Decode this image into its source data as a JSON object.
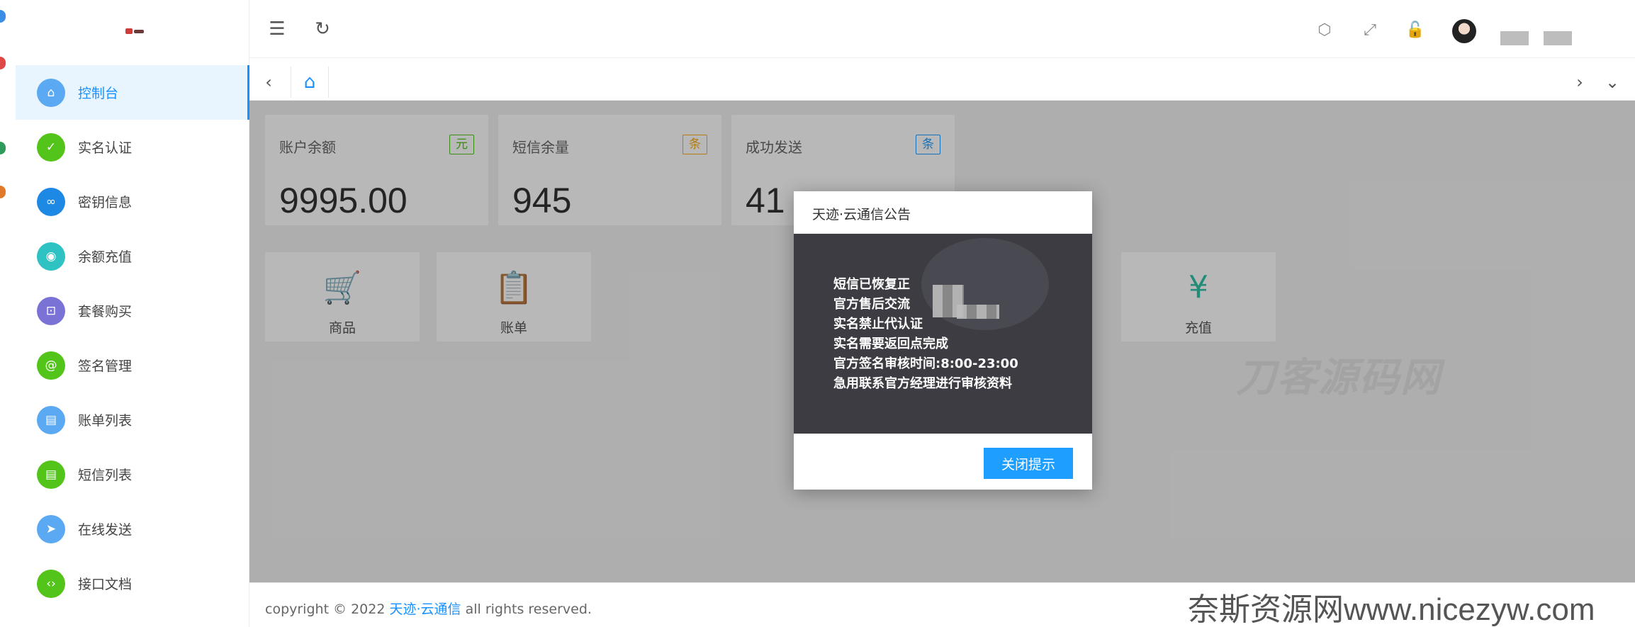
{
  "sidebar": {
    "items": [
      {
        "label": "控制台",
        "icon": "home-icon",
        "glyph": "⌂",
        "color": "#5aa9f2",
        "active": true
      },
      {
        "label": "实名认证",
        "icon": "shield-check-icon",
        "glyph": "✓",
        "color": "#52c41a",
        "active": false
      },
      {
        "label": "密钥信息",
        "icon": "link-icon",
        "glyph": "∞",
        "color": "#1e88e5",
        "active": false
      },
      {
        "label": "余额充值",
        "icon": "coin-icon",
        "glyph": "◉",
        "color": "#2fc2c2",
        "active": false
      },
      {
        "label": "套餐购买",
        "icon": "cart-icon",
        "glyph": "⊡",
        "color": "#7b72d6",
        "active": false
      },
      {
        "label": "签名管理",
        "icon": "at-icon",
        "glyph": "@",
        "color": "#52c41a",
        "active": false
      },
      {
        "label": "账单列表",
        "icon": "document-icon",
        "glyph": "▤",
        "color": "#5aa9f2",
        "active": false
      },
      {
        "label": "短信列表",
        "icon": "message-icon",
        "glyph": "▤",
        "color": "#52c41a",
        "active": false
      },
      {
        "label": "在线发送",
        "icon": "send-icon",
        "glyph": "➤",
        "color": "#5aa9f2",
        "active": false
      },
      {
        "label": "接口文档",
        "icon": "code-icon",
        "glyph": "‹›",
        "color": "#52c41a",
        "active": false
      }
    ]
  },
  "header": {
    "icons": [
      "menu-fold-icon",
      "refresh-icon",
      "tag-icon",
      "fullscreen-icon",
      "lock-icon"
    ]
  },
  "stats": [
    {
      "title": "账户余额",
      "badge": "元",
      "badge_color": "#52c41a",
      "value": "9995.00"
    },
    {
      "title": "短信余量",
      "badge": "条",
      "badge_color": "#faad14",
      "value": "945"
    },
    {
      "title": "成功发送",
      "badge": "条",
      "badge_color": "#1e9fff",
      "value": "41"
    }
  ],
  "shortcuts": [
    {
      "label": "商品",
      "icon": "cart-icon",
      "glyph": "🛒",
      "color": "#ff7a45"
    },
    {
      "label": "账单",
      "icon": "clipboard-icon",
      "glyph": "📋",
      "color": "#7b72d6"
    },
    {
      "label": "充值",
      "icon": "yen-icon",
      "glyph": "¥",
      "color": "#2fc2a5"
    }
  ],
  "modal": {
    "title": "天迹·云通信公告",
    "lines": [
      "短信已恢复正",
      "官方售后交流",
      "实名禁止代认证",
      "实名需要返回点完成",
      "官方签名审核时间:8:00-23:00",
      "急用联系官方经理进行审核资料"
    ],
    "close_label": "关闭提示"
  },
  "footer": {
    "prefix": "copyright © 2022 ",
    "brand": "天迹·云通信",
    "suffix": " all rights reserved."
  },
  "watermarks": {
    "center": "刀客源码网",
    "bottom": "奈斯资源网www.nicezyw.com"
  },
  "colors": {
    "accent": "#1890ff",
    "button": "#1e9fff",
    "modal_body": "#3d3c42"
  }
}
